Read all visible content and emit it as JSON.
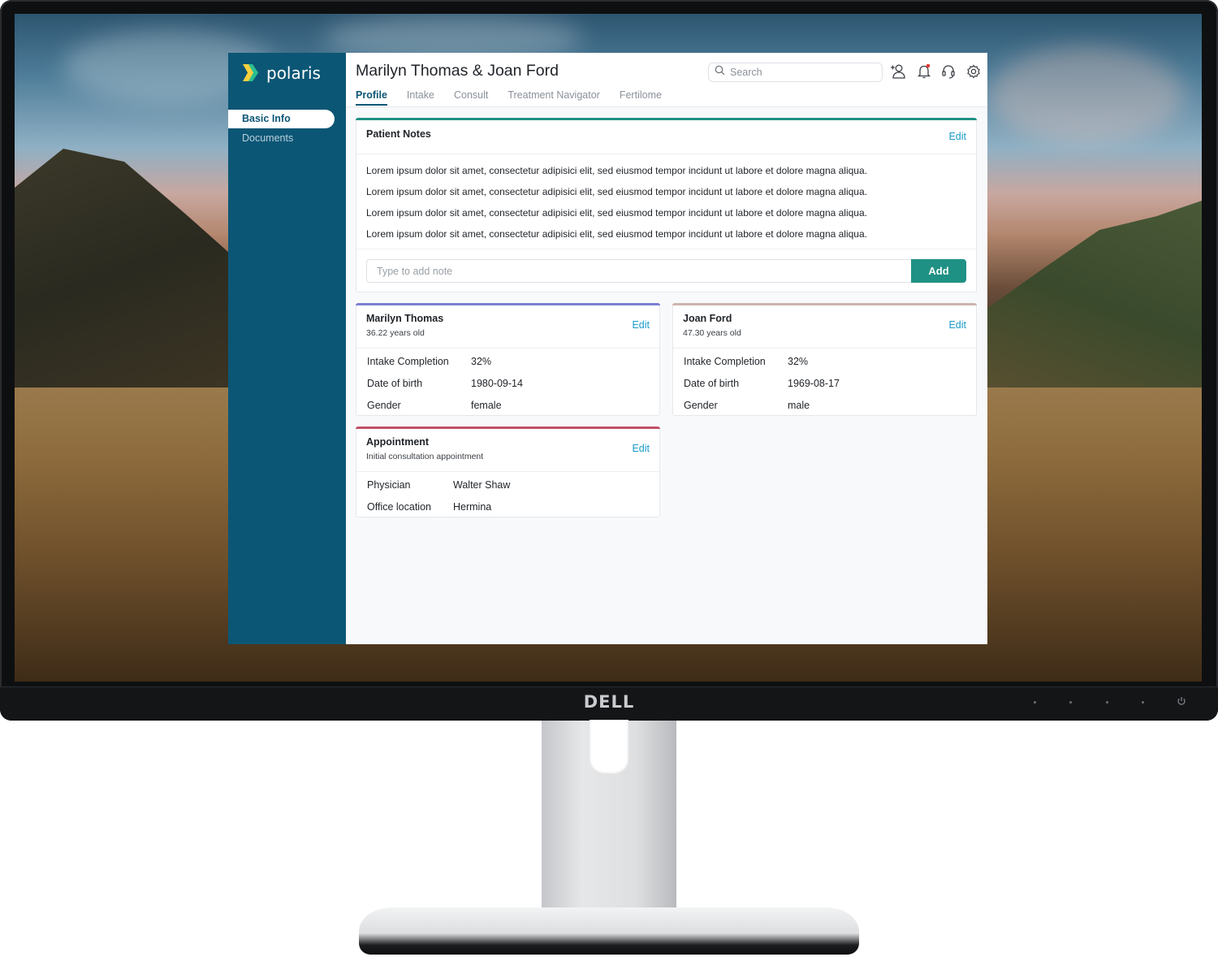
{
  "monitor": {
    "brand": "DELL"
  },
  "app": {
    "logo_text": "polaris",
    "sidebar": {
      "items": [
        {
          "label": "Basic Info",
          "active": true
        },
        {
          "label": "Documents",
          "active": false
        }
      ]
    },
    "header": {
      "title": "Marilyn Thomas & Joan Ford",
      "tabs": [
        {
          "label": "Profile",
          "active": true
        },
        {
          "label": "Intake"
        },
        {
          "label": "Consult"
        },
        {
          "label": "Treatment Navigator"
        },
        {
          "label": "Fertilome"
        }
      ],
      "search_placeholder": "Search",
      "icons": [
        "add-user-icon",
        "bell-icon",
        "headset-icon",
        "gear-icon"
      ],
      "notification_dot_color": "#e53935"
    },
    "patient_notes": {
      "title": "Patient Notes",
      "edit_label": "Edit",
      "accent": "#1f9184",
      "notes": [
        "Lorem ipsum dolor sit amet, consectetur adipisici elit, sed eiusmod tempor incidunt ut labore et dolore magna aliqua.",
        "Lorem ipsum dolor sit amet, consectetur adipisici elit, sed eiusmod tempor incidunt ut labore et dolore magna aliqua.",
        "Lorem ipsum dolor sit amet, consectetur adipisici elit, sed eiusmod tempor incidunt ut labore et dolore magna aliqua.",
        "Lorem ipsum dolor sit amet, consectetur adipisici elit, sed eiusmod tempor incidunt ut labore et dolore magna aliqua."
      ],
      "input_placeholder": "Type to add note",
      "add_label": "Add"
    },
    "patients": [
      {
        "name": "Marilyn Thomas",
        "age": "36.22 years old",
        "edit_label": "Edit",
        "accent": "#7b7fcf",
        "fields": [
          {
            "label": "Intake Completion",
            "value": "32%"
          },
          {
            "label": "Date of birth",
            "value": "1980-09-14"
          },
          {
            "label": "Gender",
            "value": "female"
          }
        ]
      },
      {
        "name": "Joan Ford",
        "age": "47.30 years old",
        "edit_label": "Edit",
        "accent": "#cbb5ae",
        "fields": [
          {
            "label": "Intake Completion",
            "value": "32%"
          },
          {
            "label": "Date of birth",
            "value": "1969-08-17"
          },
          {
            "label": "Gender",
            "value": "male"
          }
        ]
      }
    ],
    "appointment": {
      "title": "Appointment",
      "subtitle": "Initial consultation appointment",
      "edit_label": "Edit",
      "accent": "#c0506a",
      "fields": [
        {
          "label": "Physician",
          "value": "Walter Shaw"
        },
        {
          "label": "Office location",
          "value": "Hermina"
        }
      ]
    }
  }
}
